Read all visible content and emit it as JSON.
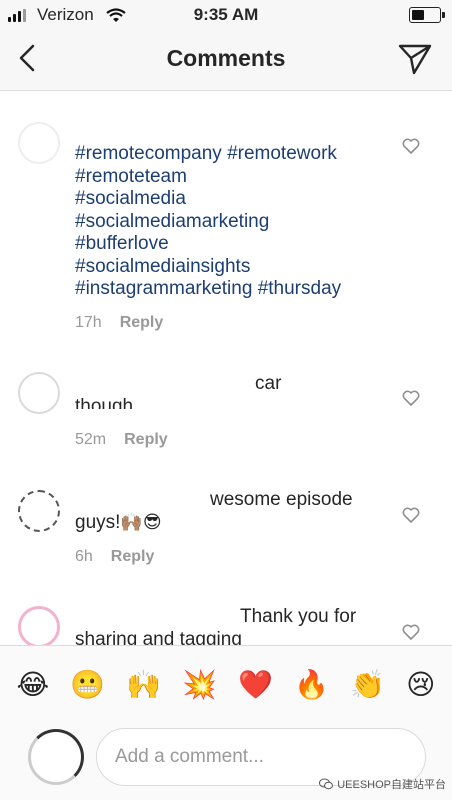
{
  "status_bar": {
    "carrier": "Verizon",
    "time": "9:35 AM"
  },
  "nav": {
    "title": "Comments",
    "back_icon": "chevron-left-icon",
    "send_icon": "paper-plane-icon"
  },
  "comments": [
    {
      "lines": [
        "#remotecompany #remotework",
        "#remoteteam",
        "#socialmedia",
        "#socialmediamarketing",
        "#bufferlove",
        "#socialmediainsights",
        "#instagrammarketing #thursday"
      ],
      "time": "17h",
      "reply": "Reply"
    },
    {
      "text_end": "car",
      "text_line2": "though...",
      "time": "52m",
      "reply": "Reply"
    },
    {
      "text_end": "wesome episode",
      "text_line2": "guys!",
      "emojis": "🙌🏽😎",
      "time": "6h",
      "reply": "Reply"
    },
    {
      "text_end": "Thank you for",
      "text_line2": "sharing and tagging"
    }
  ],
  "emoji_bar": [
    "😂",
    "😬",
    "🙌",
    "💥",
    "❤️",
    "🔥",
    "👏",
    "😢"
  ],
  "comment_input": {
    "placeholder": "Add a comment..."
  },
  "watermark": {
    "text": "UEESHOP自建站平台"
  },
  "colors": {
    "hashtag": "#1d3e72",
    "meta": "#999999",
    "nav_bg": "#f7f7f7",
    "heart_stroke": "#8e8e8e"
  }
}
